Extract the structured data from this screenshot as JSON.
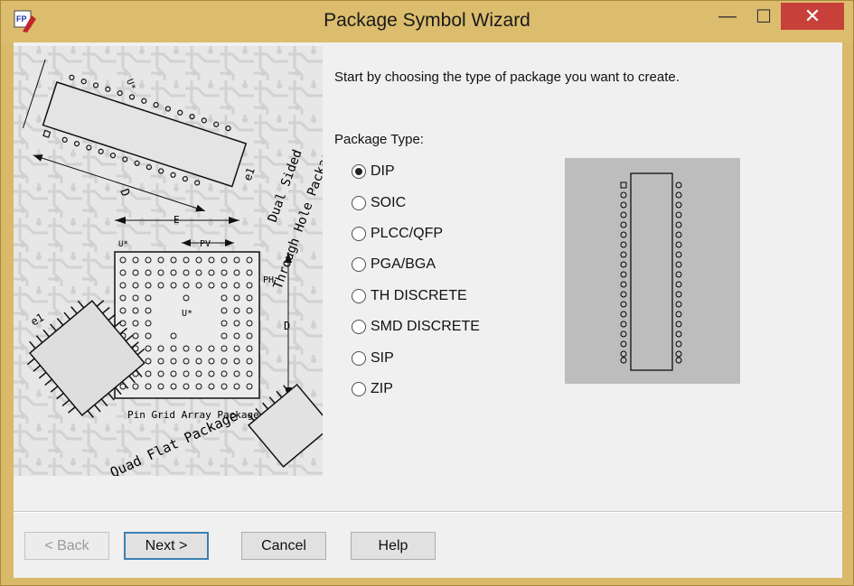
{
  "window": {
    "title": "Package Symbol Wizard",
    "minimize_glyph": "—",
    "maximize_glyph": "☐",
    "close_glyph": "✕"
  },
  "content": {
    "instruction": "Start by choosing the type of package you want to create.",
    "package_type_label": "Package Type:",
    "options": [
      {
        "label": "DIP",
        "selected": true
      },
      {
        "label": "SOIC",
        "selected": false
      },
      {
        "label": "PLCC/QFP",
        "selected": false
      },
      {
        "label": "PGA/BGA",
        "selected": false
      },
      {
        "label": "TH DISCRETE",
        "selected": false
      },
      {
        "label": "SMD DISCRETE",
        "selected": false
      },
      {
        "label": "SIP",
        "selected": false
      },
      {
        "label": "ZIP",
        "selected": false
      }
    ]
  },
  "illustration": {
    "labels": {
      "e": "E",
      "d": "D",
      "u1": "U*",
      "u2": "U*",
      "u3": "U*",
      "e1a": "e1",
      "e1b": "e1",
      "pv": "PV",
      "ph": "PH",
      "d2": "D",
      "text_dual": "Dual Sided",
      "text_through": "Through Hole Package",
      "text_pga": "Pin Grid Array Package",
      "text_quad": "Quad Flat Package"
    }
  },
  "buttons": {
    "back": "< Back",
    "next": "Next >",
    "cancel": "Cancel",
    "help": "Help"
  },
  "colors": {
    "titlebar": "#dcbd6e",
    "close": "#c7403a",
    "preview_bg": "#bdbdbd",
    "dialog_bg": "#f0f0f0"
  },
  "icons": {
    "app": "package-wizard-app-icon",
    "radio_selected": "radio-checked-icon",
    "radio_unselected": "radio-unchecked-icon"
  }
}
